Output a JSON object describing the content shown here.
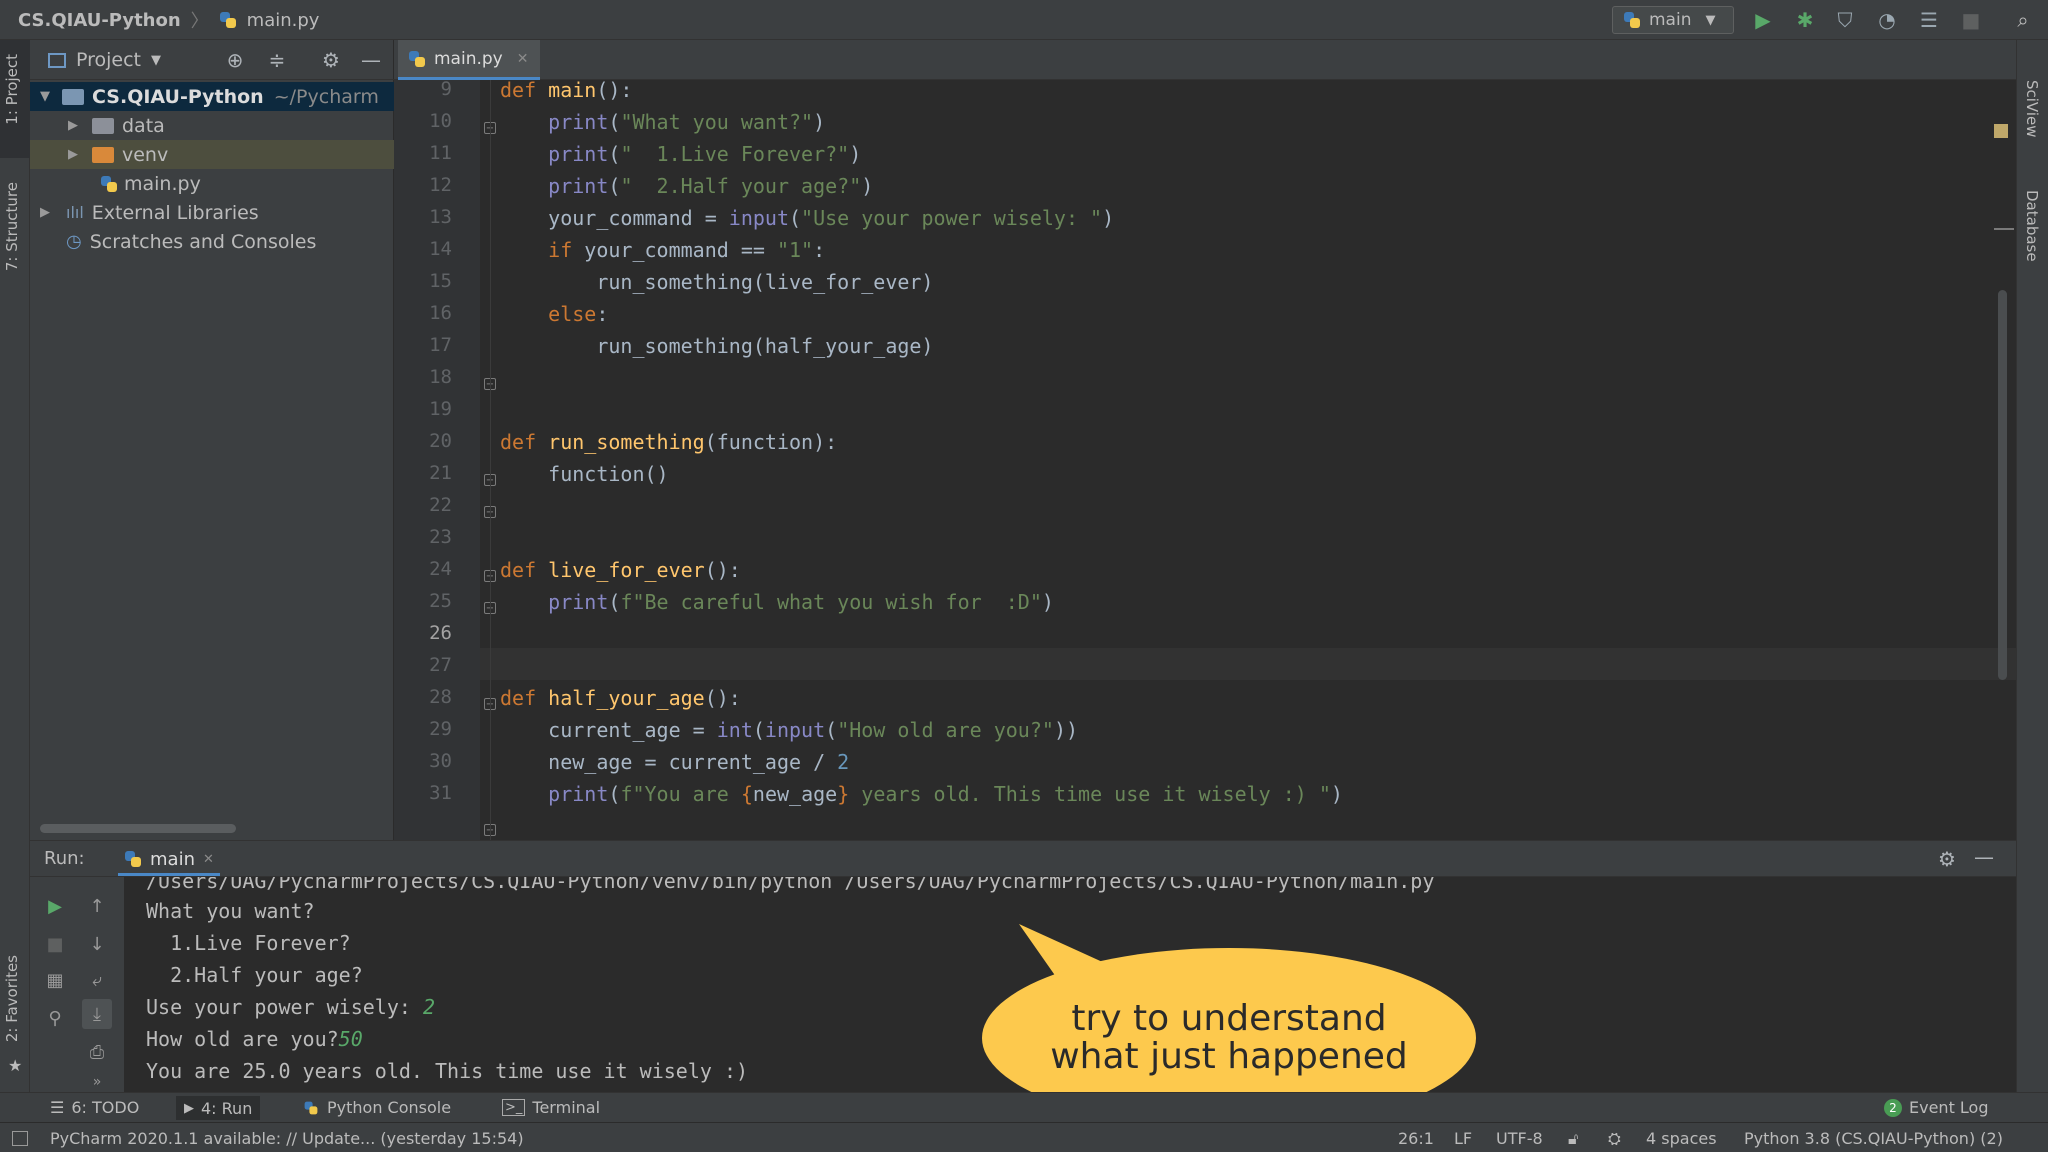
{
  "navbar": {
    "project": "CS.QIAU-Python",
    "file": "main.py",
    "run_config": "main"
  },
  "left_strip": {
    "project_tab": "1: Project",
    "structure_tab": "7: Structure",
    "favorites_tab": "2: Favorites"
  },
  "right_strip": {
    "sciview_tab": "SciView",
    "database_tab": "Database"
  },
  "project_panel": {
    "title": "Project",
    "root": {
      "name": "CS.QIAU-Python",
      "path": "~/Pycharm"
    },
    "items": [
      "data",
      "venv",
      "main.py",
      "External Libraries",
      "Scratches and Consoles"
    ]
  },
  "editor": {
    "tab": "main.py",
    "line_numbers": [
      "9",
      "10",
      "11",
      "12",
      "13",
      "14",
      "15",
      "16",
      "17",
      "18",
      "19",
      "20",
      "21",
      "22",
      "23",
      "24",
      "25",
      "26",
      "27",
      "28",
      "29",
      "30",
      "31"
    ],
    "current_line": "26"
  },
  "run_panel": {
    "label": "Run:",
    "tab": "main",
    "output": [
      "/Users/UAG/PycharmProjects/CS.QIAU-Python/venv/bin/python /Users/UAG/PycharmProjects/CS.QIAU-Python/main.py",
      "What you want?",
      "  1.Live Forever?",
      "  2.Half your age?",
      "Use your power wisely: ",
      "How old are you?",
      "You are 25.0 years old. This time use it wisely :)"
    ],
    "input1": "2",
    "input2": "50"
  },
  "bottom_tabs": {
    "todo": "6: TODO",
    "run": "4: Run",
    "python_console": "Python Console",
    "terminal": "Terminal",
    "event_log": "Event Log",
    "event_count": "2"
  },
  "status": {
    "message": "PyCharm 2020.1.1 available: // Update... (yesterday 15:54)",
    "position": "26:1",
    "line_sep": "LF",
    "encoding": "UTF-8",
    "indent": "4 spaces",
    "interpreter": "Python 3.8 (CS.QIAU-Python) (2)"
  },
  "callout": {
    "line1": "try to understand",
    "line2": "what just happened"
  },
  "colors": {
    "accent": "#4a88c7",
    "bubble": "#fdc94d",
    "keyword": "#cc7832",
    "function": "#ffc66d",
    "string": "#6a8759",
    "number": "#6897bb",
    "run_green": "#59a869"
  }
}
